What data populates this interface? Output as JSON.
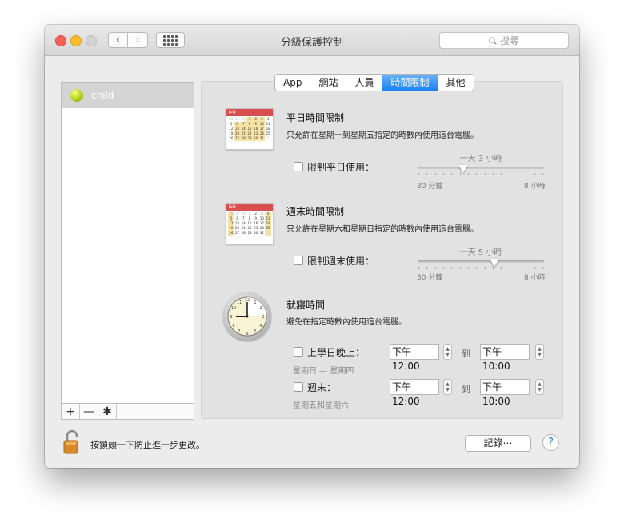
{
  "window": {
    "title": "分級保護控制",
    "search_placeholder": "搜尋"
  },
  "sidebar": {
    "selected_user": "child",
    "buttons": [
      "+",
      "—",
      "✱"
    ]
  },
  "tabs": [
    "App",
    "網站",
    "人員",
    "時間限制",
    "其他"
  ],
  "active_tab": "時間限制",
  "weekday": {
    "calendar_month": "July",
    "title": "平日時間限制",
    "desc": "只允許在星期一到星期五指定的時數內使用這台電腦。",
    "checkbox_label": "限制平日使用：",
    "slider_value_label": "一天 3 小時",
    "slider_min": "30 分鐘",
    "slider_max": "8 小時",
    "slider_level": 0.36
  },
  "weekend": {
    "calendar_month": "July",
    "title": "週末時間限制",
    "desc": "只允許在星期六和星期日指定的時數內使用這台電腦。",
    "checkbox_label": "限制週末使用：",
    "slider_value_label": "一天 5 小時",
    "slider_min": "30 分鐘",
    "slider_max": "8 小時",
    "slider_level": 0.61
  },
  "bedtime": {
    "title": "就寢時間",
    "desc": "避免在指定時數內使用這台電腦。",
    "school_night": {
      "label": "上學日晚上：",
      "from": "下午12:00",
      "to_label": "到",
      "to": "下午10:00",
      "note": "星期日 — 星期四"
    },
    "weekend": {
      "label": "週末：",
      "from": "下午12:00",
      "to_label": "到",
      "to": "下午10:00",
      "note": "星期五和星期六"
    }
  },
  "footer": {
    "lock_text": "按鎖頭一下防止進一步更改。",
    "logs_button": "記錄⋯",
    "help_button": "?"
  },
  "colors": {
    "accent": "#1a82f7",
    "calendar_header": "#d94f4f"
  }
}
